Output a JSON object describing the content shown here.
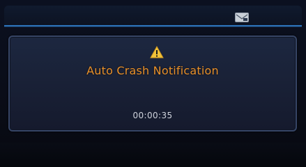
{
  "status_bar": {
    "icon": "message-envelope-icon"
  },
  "dialog": {
    "icon": "warning-icon",
    "title": "Auto Crash Notification",
    "timer": "00:00:35"
  },
  "colors": {
    "title": "#e8902a",
    "timer": "#cfd3dc",
    "warning_fill": "#f0c23a",
    "accent_line": "#2b6fb5",
    "popup_border": "#364566"
  }
}
